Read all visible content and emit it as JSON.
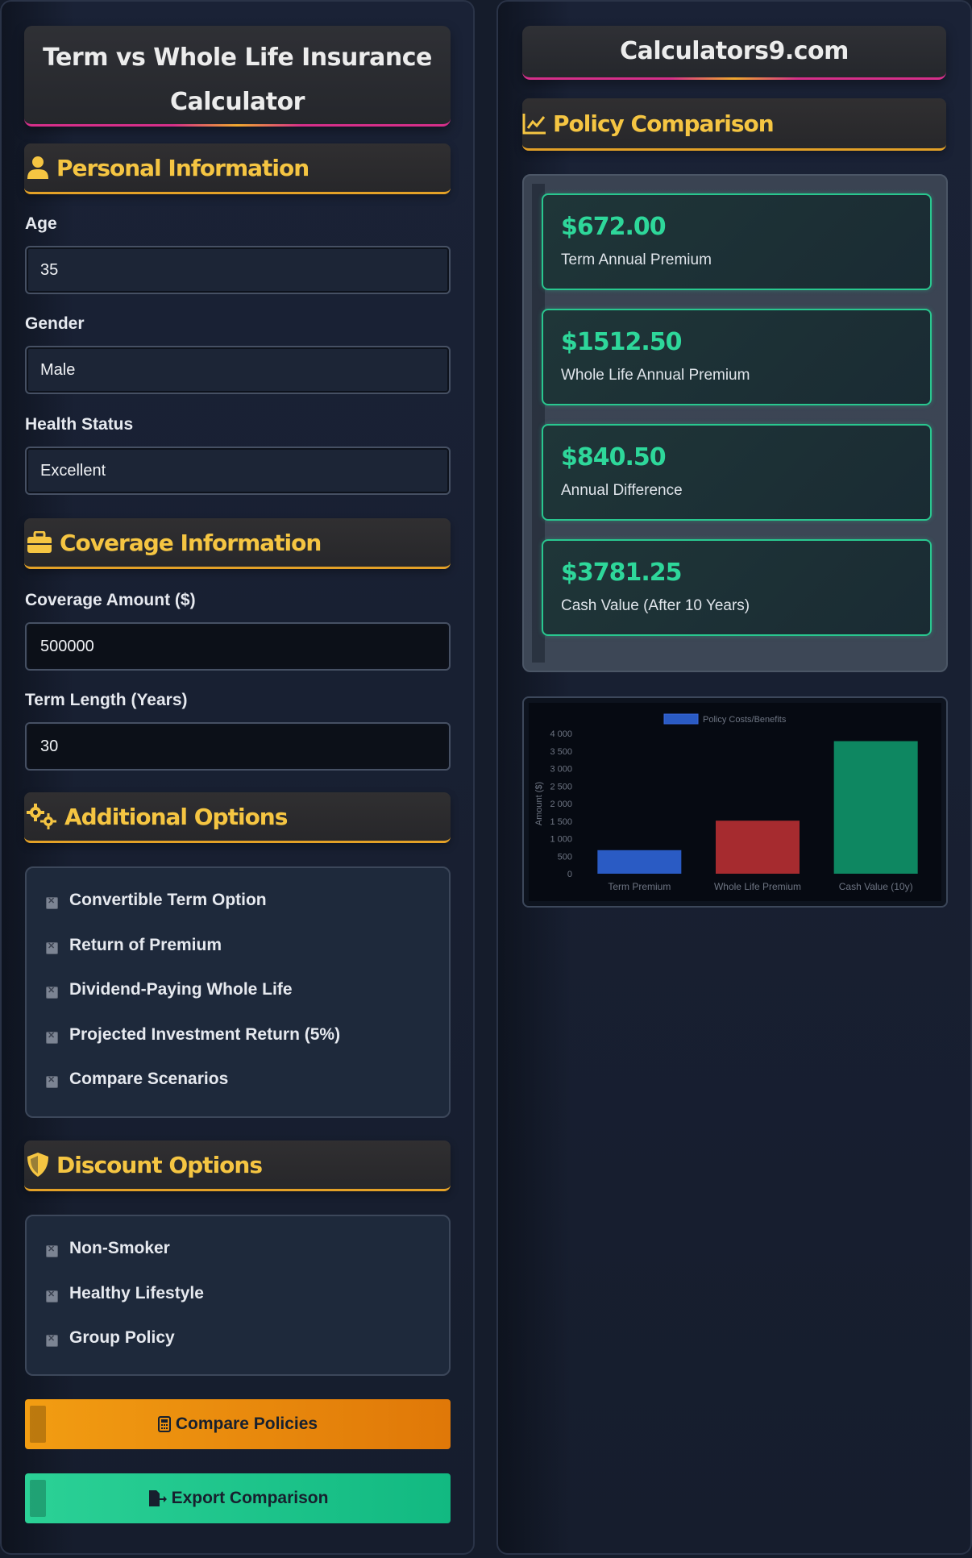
{
  "left": {
    "title_line1": "Term vs Whole Life Insurance",
    "title_line2": "Calculator",
    "personal": {
      "header": "Personal Information",
      "age_label": "Age",
      "age_value": "35",
      "gender_label": "Gender",
      "gender_value": "Male",
      "health_label": "Health Status",
      "health_value": "Excellent"
    },
    "coverage": {
      "header": "Coverage Information",
      "amount_label": "Coverage Amount ($)",
      "amount_value": "500000",
      "term_label": "Term Length (Years)",
      "term_value": "30"
    },
    "additional": {
      "header": "Additional Options",
      "items": [
        "Convertible Term Option",
        "Return of Premium",
        "Dividend-Paying Whole Life",
        "Projected Investment Return (5%)",
        "Compare Scenarios"
      ]
    },
    "discount": {
      "header": "Discount Options",
      "items": [
        "Non-Smoker",
        "Healthy Lifestyle",
        "Group Policy"
      ]
    },
    "compare_button": "Compare Policies",
    "export_button": "Export Comparison"
  },
  "right": {
    "site_title": "Calculators9.com",
    "comparison_header": "Policy Comparison",
    "results": [
      {
        "value": "$672.00",
        "label": "Term Annual Premium"
      },
      {
        "value": "$1512.50",
        "label": "Whole Life Annual Premium"
      },
      {
        "value": "$840.50",
        "label": "Annual Difference"
      },
      {
        "value": "$3781.25",
        "label": "Cash Value (After 10 Years)"
      }
    ]
  },
  "colors": {
    "accent_yellow": "#f5c542",
    "accent_green": "#2ed79a",
    "bar_blue": "#2a5bc4",
    "bar_red": "#a62b2f",
    "bar_green": "#0e8761"
  },
  "chart_data": {
    "type": "bar",
    "categories": [
      "Term Premium",
      "Whole Life Premium",
      "Cash Value (10y)"
    ],
    "series": [
      {
        "name": "Policy Costs/Benefits",
        "values": [
          672.0,
          1512.5,
          3781.25
        ]
      }
    ],
    "ylabel": "Amount ($)",
    "ylim": [
      0,
      4000
    ],
    "yticks": [
      "0",
      "500",
      "1 000",
      "1 500",
      "2 000",
      "2 500",
      "3 000",
      "3 500",
      "4 000"
    ],
    "legend": "top",
    "grid": false
  }
}
